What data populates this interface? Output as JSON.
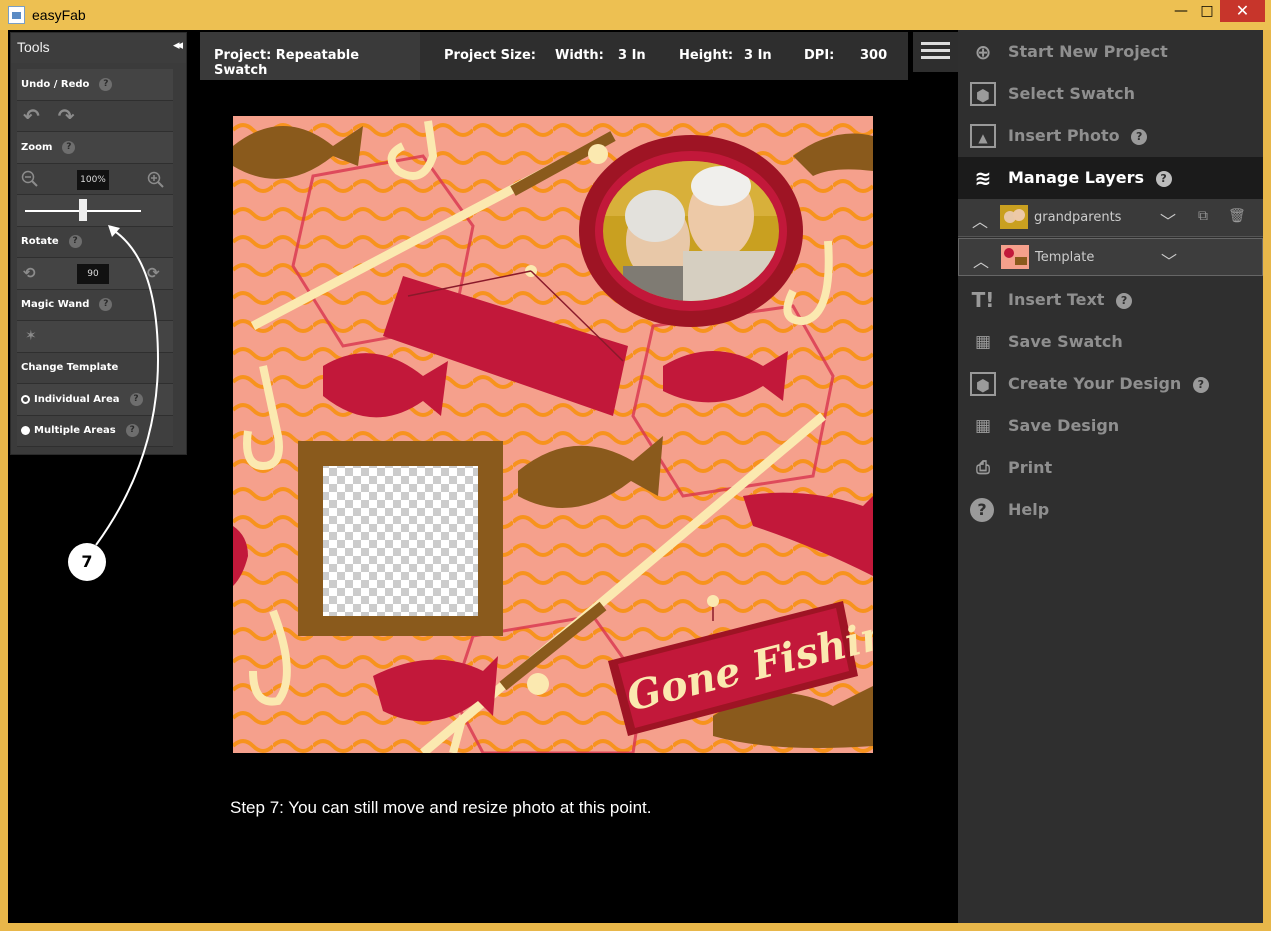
{
  "window": {
    "title": "easyFab",
    "minimize": "—",
    "maximize": "□",
    "close": "✕"
  },
  "tools": {
    "title": "Tools",
    "collapse_icon": "◂◂",
    "undo_redo_label": "Undo / Redo",
    "zoom_label": "Zoom",
    "zoom_value": "100%",
    "zoom_slider_level": 0.5,
    "rotate_label": "Rotate",
    "rotate_value": "90",
    "magic_wand_label": "Magic Wand",
    "change_template_label": "Change Template",
    "individual_area_label": "Individual Area",
    "multiple_areas_label": "Multiple Areas",
    "help_glyph": "?"
  },
  "infobar": {
    "project": "Project: Repeatable Swatch",
    "project_size": "Project Size:",
    "width_label": "Width:",
    "width_value": "3 In",
    "height_label": "Height:",
    "height_value": "3 In",
    "dpi_label": "DPI:",
    "dpi_value": "300"
  },
  "canvas": {
    "sign_text": "Gone Fishin'"
  },
  "caption": "Step 7:  You can still move and resize photo at this point.",
  "annotation": {
    "number": "7"
  },
  "menu": {
    "start_new_project": "Start New Project",
    "select_swatch": "Select Swatch",
    "insert_photo": "Insert Photo",
    "manage_layers": "Manage Layers",
    "insert_text": "Insert Text",
    "save_swatch": "Save Swatch",
    "create_your_design": "Create Your Design",
    "save_design": "Save Design",
    "print": "Print",
    "help": "Help"
  },
  "layers": [
    {
      "name": "grandparents"
    },
    {
      "name": "Template"
    }
  ],
  "colors": {
    "background_pink": "#f5a08c",
    "wave_orange": "#f7931e",
    "crimson": "#c2183a",
    "brown": "#8a5a1c",
    "cream": "#fbe9b0"
  }
}
